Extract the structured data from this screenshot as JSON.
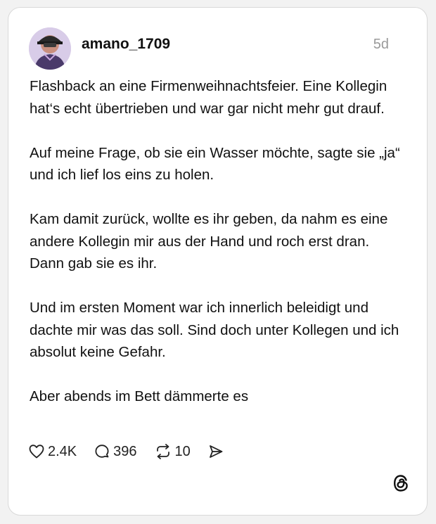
{
  "post": {
    "username": "amano_1709",
    "time_ago": "5d",
    "paragraphs": [
      "Flashback an eine Firmenweihnachtsfeier. Eine Kollegin hat‘s echt übertrieben und war gar nicht mehr gut drauf.",
      "Auf meine Frage, ob sie ein Wasser möchte, sagte sie „ja“ und ich lief los eins zu holen.",
      "Kam damit zurück, wollte es ihr geben, da nahm es eine andere Kollegin mir aus der Hand und roch erst dran. Dann gab sie es ihr.",
      "Und im ersten Moment war ich innerlich beleidigt und dachte mir was das soll. Sind doch unter Kollegen und ich absolut keine Gefahr.",
      "Aber abends im Bett dämmerte es"
    ]
  },
  "actions": {
    "likes": "2.4K",
    "comments": "396",
    "reposts": "10"
  },
  "icons": {
    "like": "heart-icon",
    "comment": "comment-bubble-icon",
    "repost": "repost-icon",
    "share": "share-send-icon",
    "logo": "threads-logo-icon"
  },
  "colors": {
    "background": "#f2f2f2",
    "card": "#ffffff",
    "text": "#111111",
    "muted": "#9a9a9a"
  }
}
